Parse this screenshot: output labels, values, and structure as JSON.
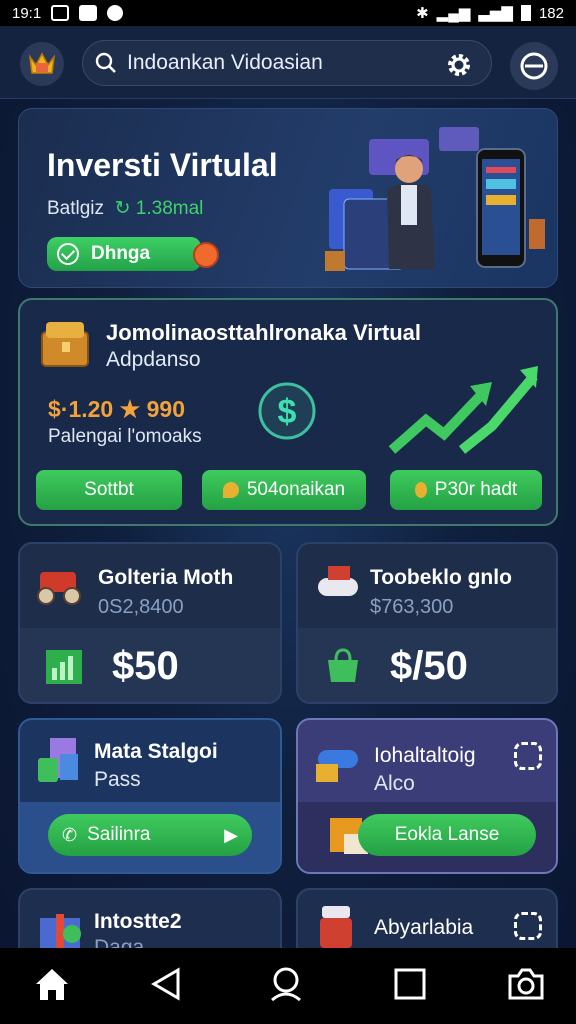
{
  "status_bar": {
    "time": "19:1",
    "right_text": "182"
  },
  "search": {
    "text": "Indoankan Vidoasian"
  },
  "hero": {
    "title": "Inversti Virtulal",
    "sub_prefix": "Batlgiz",
    "sub_value": "1.38mal",
    "button": "Dhnga"
  },
  "feature": {
    "title": "Jomolinaosttahlronaka Virtual",
    "subtitle": "Adpdanso",
    "price": "$·1.20 ★ 990",
    "note": "Palengai l'omoaks",
    "buttons": [
      "Sottbt",
      "504onaikan",
      "P30r hadt"
    ]
  },
  "shop_cards": [
    {
      "title": "Golteria Moth",
      "subtitle": "0S2,8400",
      "price": "$50"
    },
    {
      "title": "Toobeklo gnlo",
      "subtitle": "$763,300",
      "price": "$/50"
    }
  ],
  "pass_cards": [
    {
      "title": "Mata Stalgoi",
      "subtitle": "Pass",
      "button": "Sailinra"
    },
    {
      "title": "Iohaltaltoig",
      "subtitle": "Alco",
      "button": "Eokla Lanse"
    }
  ],
  "more_cards": [
    {
      "title": "Intostte2",
      "subtitle": "Daga"
    },
    {
      "title": "Abyarlabia"
    }
  ],
  "colors": {
    "accent_green": "#2fb552",
    "gold": "#f2a23a",
    "bg": "#0f1f3d"
  }
}
